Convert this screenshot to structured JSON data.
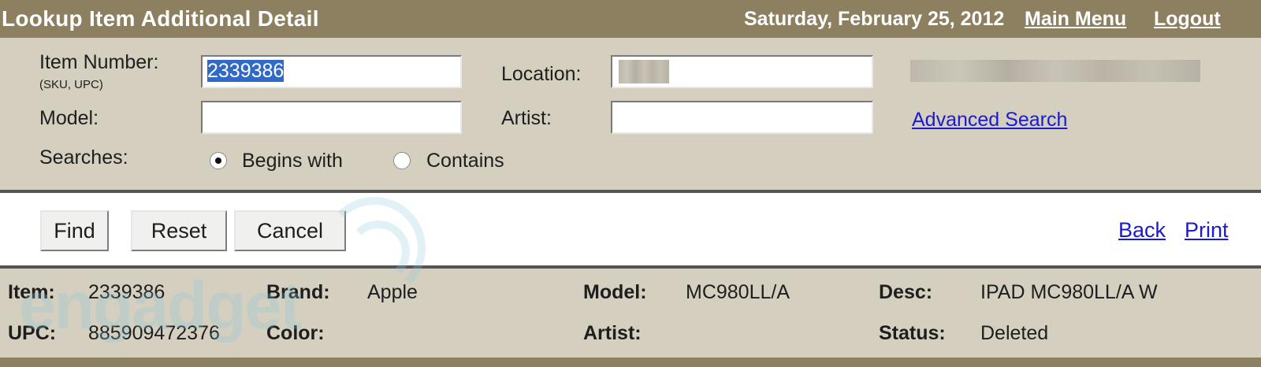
{
  "header": {
    "title": "Lookup Item Additional Detail",
    "date": "Saturday, February 25, 2012",
    "main_menu": "Main Menu",
    "logout": "Logout"
  },
  "search": {
    "item_number_label": "Item Number:",
    "item_number_hint": "(SKU, UPC)",
    "item_number_value": "2339386",
    "model_label": "Model:",
    "model_value": "",
    "location_label": "Location:",
    "artist_label": "Artist:",
    "artist_value": "",
    "advanced_search": "Advanced Search",
    "searches_label": "Searches:",
    "options": [
      {
        "label": "Begins with",
        "checked": true
      },
      {
        "label": "Contains",
        "checked": false
      }
    ]
  },
  "actions": {
    "find": "Find",
    "reset": "Reset",
    "cancel": "Cancel",
    "back": "Back",
    "print": "Print"
  },
  "detail": {
    "item_label": "Item:",
    "item_value": "2339386",
    "brand_label": "Brand:",
    "brand_value": "Apple",
    "model_label": "Model:",
    "model_value": "MC980LL/A",
    "desc_label": "Desc:",
    "desc_value": "IPAD MC980LL/A W",
    "upc_label": "UPC:",
    "upc_value": "885909472376",
    "color_label": "Color:",
    "color_value": "",
    "artist_label": "Artist:",
    "artist_value": "",
    "status_label": "Status:",
    "status_value": "Deleted"
  },
  "watermark": "engadget",
  "colors": {
    "title_bar": "#8d8060",
    "panel": "#d4cfbf",
    "link": "#1a1ad4",
    "selection": "#3169c6"
  }
}
